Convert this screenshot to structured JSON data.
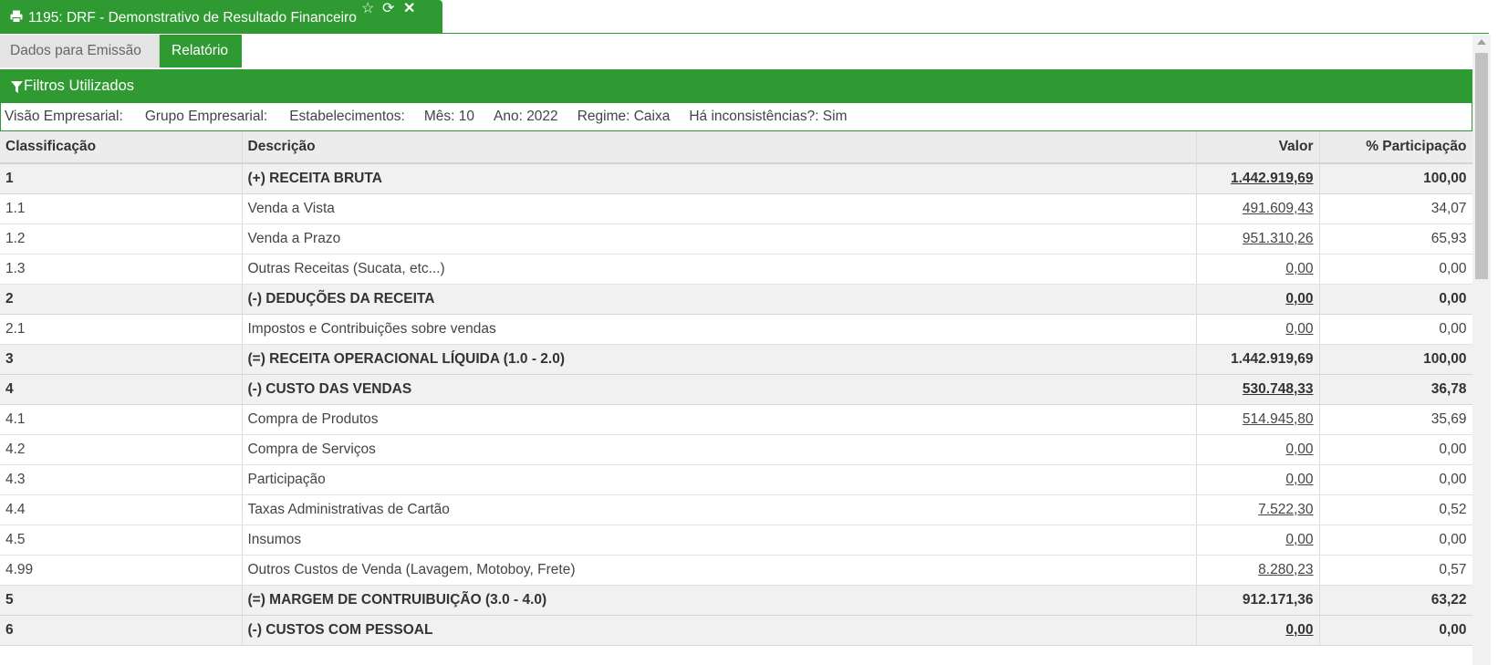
{
  "window": {
    "title": "1195: DRF - Demonstrativo de Resultado Financeiro",
    "icons": [
      "print-icon",
      "star-icon",
      "refresh-icon",
      "close-icon"
    ]
  },
  "subtabs": [
    {
      "label": "Dados para Emissão",
      "active": false
    },
    {
      "label": "Relatório",
      "active": true
    }
  ],
  "filters": {
    "header": "Filtros Utilizados",
    "items": [
      "Visão Empresarial:",
      "Grupo Empresarial:",
      "Estabelecimentos:",
      "Mês: 10",
      "Ano: 2022",
      "Regime: Caixa",
      "Há inconsistências?: Sim"
    ]
  },
  "table": {
    "columns": [
      "Classificação",
      "Descrição",
      "Valor",
      "% Participação"
    ],
    "rows": [
      {
        "cls": "1",
        "desc": "(+) RECEITA BRUTA",
        "valor": "1.442.919,69",
        "pct": "100,00",
        "total": true,
        "link": true
      },
      {
        "cls": "1.1",
        "desc": "Venda a Vista",
        "valor": "491.609,43",
        "pct": "34,07",
        "total": false,
        "link": true
      },
      {
        "cls": "1.2",
        "desc": "Venda a Prazo",
        "valor": "951.310,26",
        "pct": "65,93",
        "total": false,
        "link": true
      },
      {
        "cls": "1.3",
        "desc": "Outras Receitas (Sucata, etc...)",
        "valor": "0,00",
        "pct": "0,00",
        "total": false,
        "link": true
      },
      {
        "cls": "2",
        "desc": "(-) DEDUÇÕES DA RECEITA",
        "valor": "0,00",
        "pct": "0,00",
        "total": true,
        "link": true
      },
      {
        "cls": "2.1",
        "desc": "Impostos e Contribuições sobre vendas",
        "valor": "0,00",
        "pct": "0,00",
        "total": false,
        "link": true
      },
      {
        "cls": "3",
        "desc": "(=) RECEITA OPERACIONAL LÍQUIDA (1.0 - 2.0)",
        "valor": "1.442.919,69",
        "pct": "100,00",
        "total": true,
        "link": false
      },
      {
        "cls": "4",
        "desc": "(-) CUSTO DAS VENDAS",
        "valor": "530.748,33",
        "pct": "36,78",
        "total": true,
        "link": true
      },
      {
        "cls": "4.1",
        "desc": "Compra de Produtos",
        "valor": "514.945,80",
        "pct": "35,69",
        "total": false,
        "link": true
      },
      {
        "cls": "4.2",
        "desc": "Compra de Serviços",
        "valor": "0,00",
        "pct": "0,00",
        "total": false,
        "link": true
      },
      {
        "cls": "4.3",
        "desc": "Participação",
        "valor": "0,00",
        "pct": "0,00",
        "total": false,
        "link": true
      },
      {
        "cls": "4.4",
        "desc": "Taxas Administrativas de Cartão",
        "valor": "7.522,30",
        "pct": "0,52",
        "total": false,
        "link": true
      },
      {
        "cls": "4.5",
        "desc": "Insumos",
        "valor": "0,00",
        "pct": "0,00",
        "total": false,
        "link": true
      },
      {
        "cls": "4.99",
        "desc": "Outros Custos de Venda (Lavagem, Motoboy, Frete)",
        "valor": "8.280,23",
        "pct": "0,57",
        "total": false,
        "link": true
      },
      {
        "cls": "5",
        "desc": "(=) MARGEM DE CONTRUIBUIÇÃO (3.0 - 4.0)",
        "valor": "912.171,36",
        "pct": "63,22",
        "total": true,
        "link": false
      },
      {
        "cls": "6",
        "desc": "(-) CUSTOS COM PESSOAL",
        "valor": "0,00",
        "pct": "0,00",
        "total": true,
        "link": true
      }
    ]
  },
  "colors": {
    "accent": "#2f9a32",
    "header_bg": "#ececec",
    "total_row_bg": "#f1f1f1"
  }
}
